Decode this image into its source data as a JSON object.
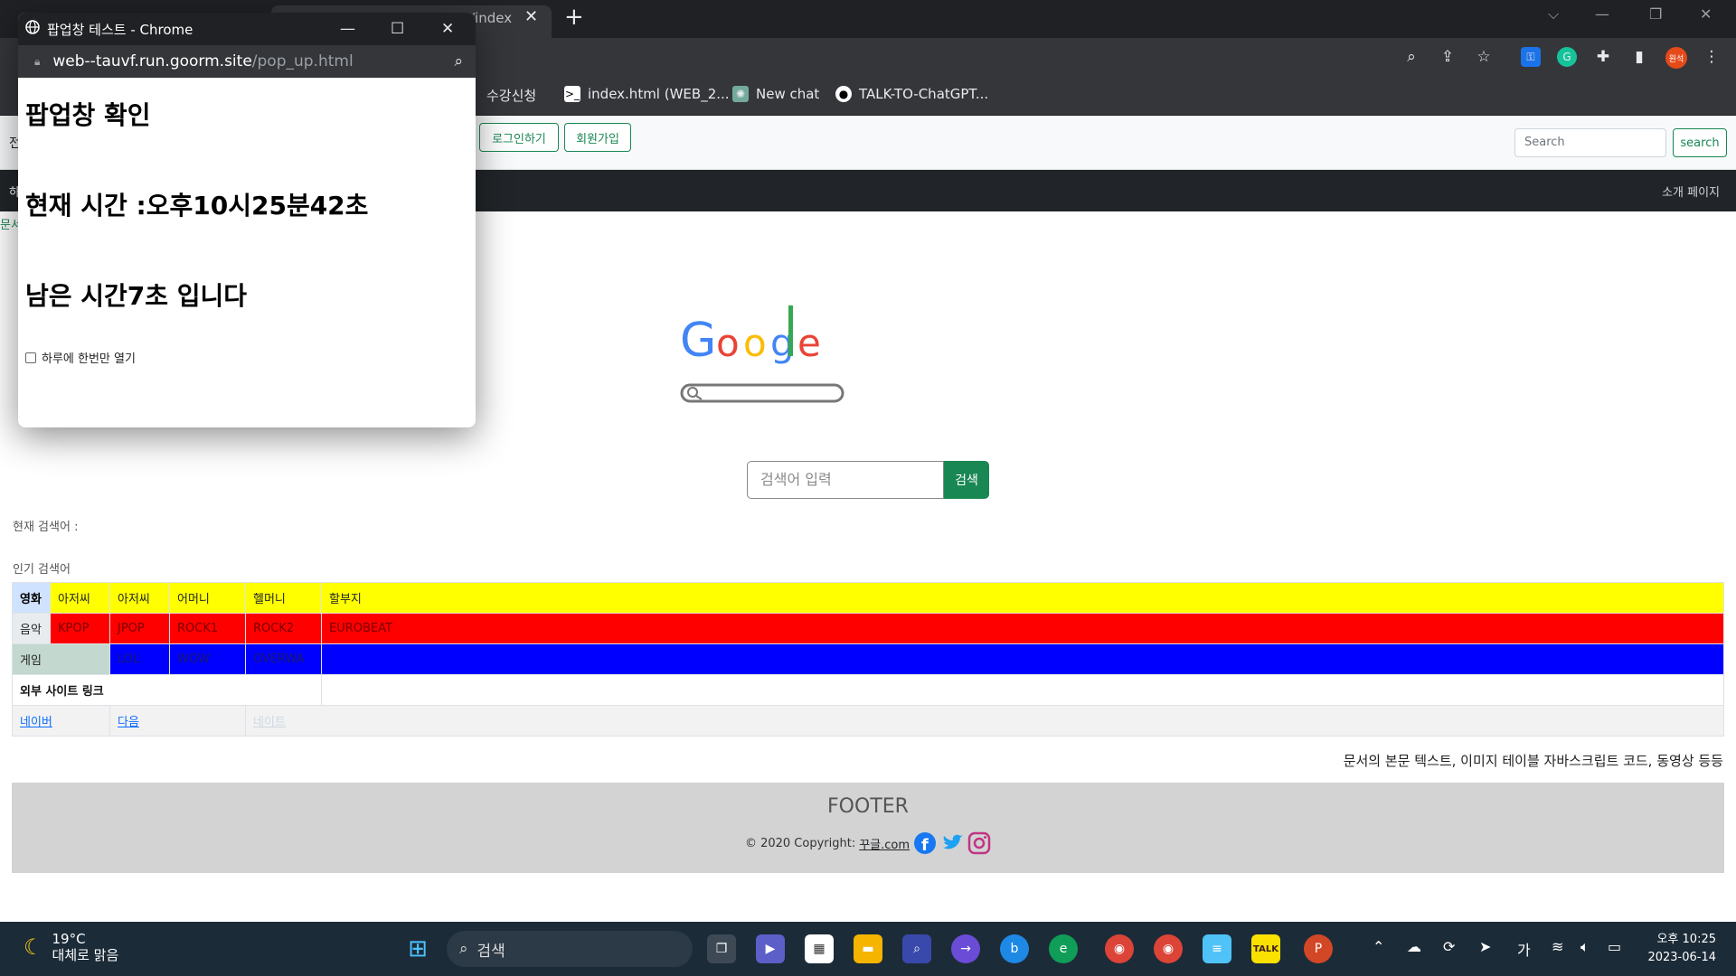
{
  "browser": {
    "tab_fragment": "/index",
    "bookmarks": [
      {
        "label": "수강신청",
        "icon": "gear-icon"
      },
      {
        "label": "index.html (WEB_2...",
        "icon": "terminal-icon"
      },
      {
        "label": "New chat",
        "icon": "openai-icon"
      },
      {
        "label": "TALK-TO-ChatGPT...",
        "icon": "github-icon"
      }
    ],
    "profile_label": "원석"
  },
  "navbar": {
    "login_label": "로그인하기",
    "signup_label": "회원가입",
    "search_placeholder": "Search",
    "search_button": "search",
    "about_link": "소개 페이지"
  },
  "main": {
    "search_placeholder": "검색어 입력",
    "search_button": "검색",
    "current_query_label": "현재 검색어 :",
    "popular_label": "인기 검색어"
  },
  "table": {
    "movie": {
      "header": "영화",
      "items": [
        "아저씨",
        "아저씨",
        "어머니",
        "헬머니",
        "할부지"
      ]
    },
    "music": {
      "header": "음악",
      "items": [
        "KPOP",
        "JPOP",
        "ROCK1",
        "ROCK2",
        "EUROBEAT"
      ]
    },
    "game": {
      "header": "게임",
      "items": [
        "LOL",
        "WOW",
        "OVERWA"
      ]
    },
    "links_header": "외부 사이트 링크",
    "links": [
      "네이버",
      "다음",
      "네이트"
    ]
  },
  "body_text": "문서의 본문 텍스트, 이미지 테이블 자바스크립트 코드, 동영상 등등",
  "footer": {
    "title": "FOOTER",
    "copyright": "© 2020 Copyright:",
    "site_link": "꾸글.com"
  },
  "popup": {
    "window_title": "팝업창 테스트 - Chrome",
    "url_host": "web--tauvf.run.goorm.site",
    "url_path": "/pop_up.html",
    "heading": "팝업창 확인",
    "current_time": "현재 시간 :오후10시25분42초",
    "remaining": "남은 시간7초 입니다",
    "checkbox_label": "하루에 한번만 열기"
  },
  "taskbar": {
    "temperature": "19°C",
    "weather": "대체로 맑음",
    "search_label": "검색",
    "ime": "가",
    "time": "오후 10:25",
    "date": "2023-06-14"
  }
}
